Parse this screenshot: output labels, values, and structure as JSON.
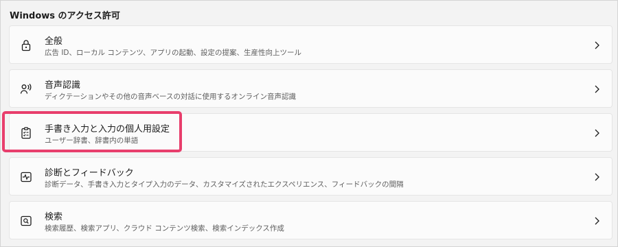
{
  "section": {
    "title": "Windows のアクセス許可"
  },
  "items": [
    {
      "title": "全般",
      "desc": "広告 ID、ローカル コンテンツ、アプリの起動、設定の提案、生産性向上ツール",
      "icon": "lock-icon"
    },
    {
      "title": "音声認識",
      "desc": "ディクテーションやその他の音声ベースの対話に使用するオンライン音声認識",
      "icon": "speech-person-icon"
    },
    {
      "title": "手書き入力と入力の個人用設定",
      "desc": "ユーザー辞書、辞書内の単語",
      "icon": "clipboard-checklist-icon"
    },
    {
      "title": "診断とフィードバック",
      "desc": "診断データ、手書き入力とタイプ入力のデータ、カスタマイズされたエクスペリエンス、フィードバックの間隔",
      "icon": "pulse-icon"
    },
    {
      "title": "検索",
      "desc": "検索履歴、検索アプリ、クラウド コンテンツ検索、検索インデックス作成",
      "icon": "search-box-icon"
    }
  ],
  "colors": {
    "highlight": "#e83e6c",
    "card": "#fbfbfb",
    "background": "#f3f3f3"
  }
}
